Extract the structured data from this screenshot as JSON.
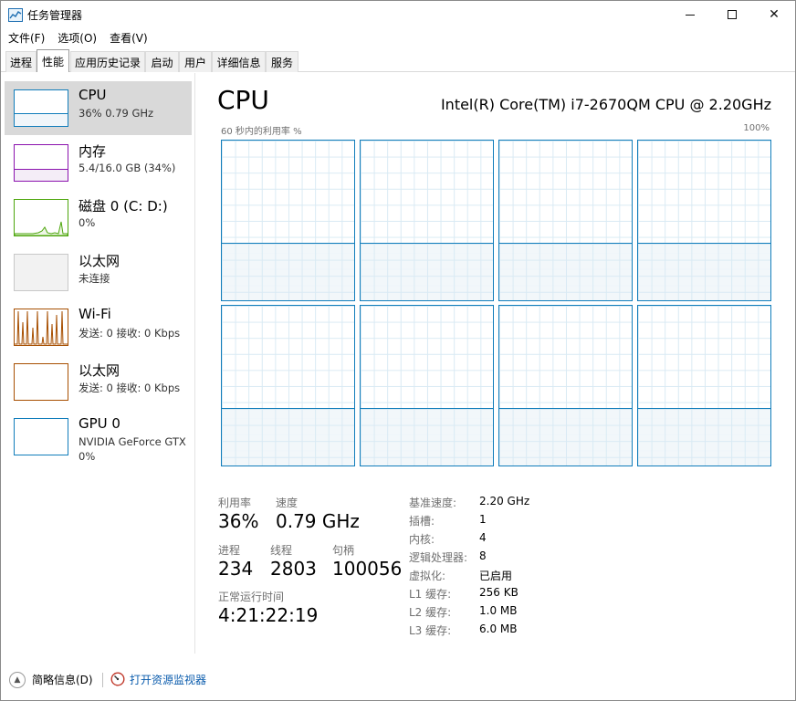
{
  "window": {
    "title": "任务管理器",
    "controls": {
      "minimize": "",
      "maximize": "",
      "close": "✕"
    }
  },
  "menu": [
    "文件(F)",
    "选项(O)",
    "查看(V)"
  ],
  "tabs": [
    {
      "label": "进程"
    },
    {
      "label": "性能",
      "active": true
    },
    {
      "label": "应用历史记录"
    },
    {
      "label": "启动"
    },
    {
      "label": "用户"
    },
    {
      "label": "详细信息"
    },
    {
      "label": "服务"
    }
  ],
  "resources": [
    {
      "name": "CPU",
      "line1": "36% 0.79 GHz",
      "line2": "",
      "color": "#117dbb",
      "selected": true
    },
    {
      "name": "内存",
      "line1": "5.4/16.0 GB (34%)",
      "line2": "",
      "color": "#8b12ae"
    },
    {
      "name": "磁盘 0 (C: D:)",
      "line1": "0%",
      "line2": "",
      "color": "#4da60c"
    },
    {
      "name": "以太网",
      "line1": "未连接",
      "line2": "",
      "color": "#a0a0a0"
    },
    {
      "name": "Wi-Fi",
      "line1": "发送: 0 接收: 0 Kbps",
      "line2": "",
      "color": "#a74f01"
    },
    {
      "name": "以太网",
      "line1": "发送: 0 接收: 0 Kbps",
      "line2": "",
      "color": "#a74f01"
    },
    {
      "name": "GPU 0",
      "line1": "NVIDIA GeForce GTX",
      "line2": "0%",
      "color": "#117dbb"
    }
  ],
  "main": {
    "title": "CPU",
    "model": "Intel(R) Core(TM) i7-2670QM CPU @ 2.20GHz",
    "graph_label": "60 秒内的利用率 %",
    "graph_max": "100%",
    "core_count": 8,
    "core_fill_percent": 36
  },
  "stats": {
    "utilization_label": "利用率",
    "utilization": "36%",
    "speed_label": "速度",
    "speed": "0.79 GHz",
    "processes_label": "进程",
    "processes": "234",
    "threads_label": "线程",
    "threads": "2803",
    "handles_label": "句柄",
    "handles": "100056",
    "uptime_label": "正常运行时间",
    "uptime": "4:21:22:19"
  },
  "specs": [
    {
      "key": "基准速度:",
      "value": "2.20 GHz"
    },
    {
      "key": "插槽:",
      "value": "1"
    },
    {
      "key": "内核:",
      "value": "4"
    },
    {
      "key": "逻辑处理器:",
      "value": "8"
    },
    {
      "key": "虚拟化:",
      "value": "已启用"
    },
    {
      "key": "L1 缓存:",
      "value": "256 KB"
    },
    {
      "key": "L2 缓存:",
      "value": "1.0 MB"
    },
    {
      "key": "L3 缓存:",
      "value": "6.0 MB"
    }
  ],
  "footer": {
    "summary_label": "简略信息(D)",
    "monitor_link": "打开资源监视器"
  },
  "icons": {
    "app": "task-manager-icon",
    "collapse": "chevron-up-icon",
    "monitor": "resource-monitor-icon"
  }
}
